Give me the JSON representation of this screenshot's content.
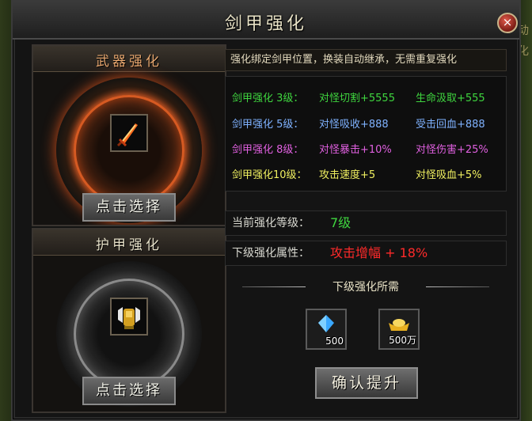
{
  "window": {
    "title": "剑甲强化",
    "close_glyph": "×"
  },
  "background": {
    "right_edge_text": "动化"
  },
  "weapon_panel": {
    "title": "武器强化",
    "title_color": "#e8a870",
    "slot_icon": "sword-icon",
    "select_button": "点击选择"
  },
  "armor_panel": {
    "title": "护甲强化",
    "title_color": "#e6e0c8",
    "slot_icon": "armor-icon",
    "select_button": "点击选择"
  },
  "description": "强化绑定剑甲位置，换装自动继承，无需重复强化",
  "attributes": [
    {
      "level": "剑甲强化 3级：",
      "attr1": "对怪切割+5555",
      "attr2": "生命汲取+555",
      "color": "#3fd63f"
    },
    {
      "level": "剑甲强化 5级：",
      "attr1": "对怪吸收+888",
      "attr2": "受击回血+888",
      "color": "#7fb2ff"
    },
    {
      "level": "剑甲强化 8级：",
      "attr1": "对怪暴击+10%",
      "attr2": "对怪伤害+25%",
      "color": "#e060e0"
    },
    {
      "level": "剑甲强化10级：",
      "attr1": "攻击速度+5",
      "attr2": "对怪吸血+5%",
      "color": "#f0f060"
    }
  ],
  "current_level": {
    "label": "当前强化等级：",
    "value": "7级",
    "color": "#3fd63f"
  },
  "next_level": {
    "label": "下级强化属性：",
    "value": "攻击增幅 + 18%",
    "color": "#ff2a2a"
  },
  "requirements": {
    "title": "下级强化所需",
    "items": [
      {
        "icon": "blue-crystal-icon",
        "quantity": "500"
      },
      {
        "icon": "gold-ingot-icon",
        "quantity": "500万"
      }
    ]
  },
  "confirm_button": "确认提升"
}
